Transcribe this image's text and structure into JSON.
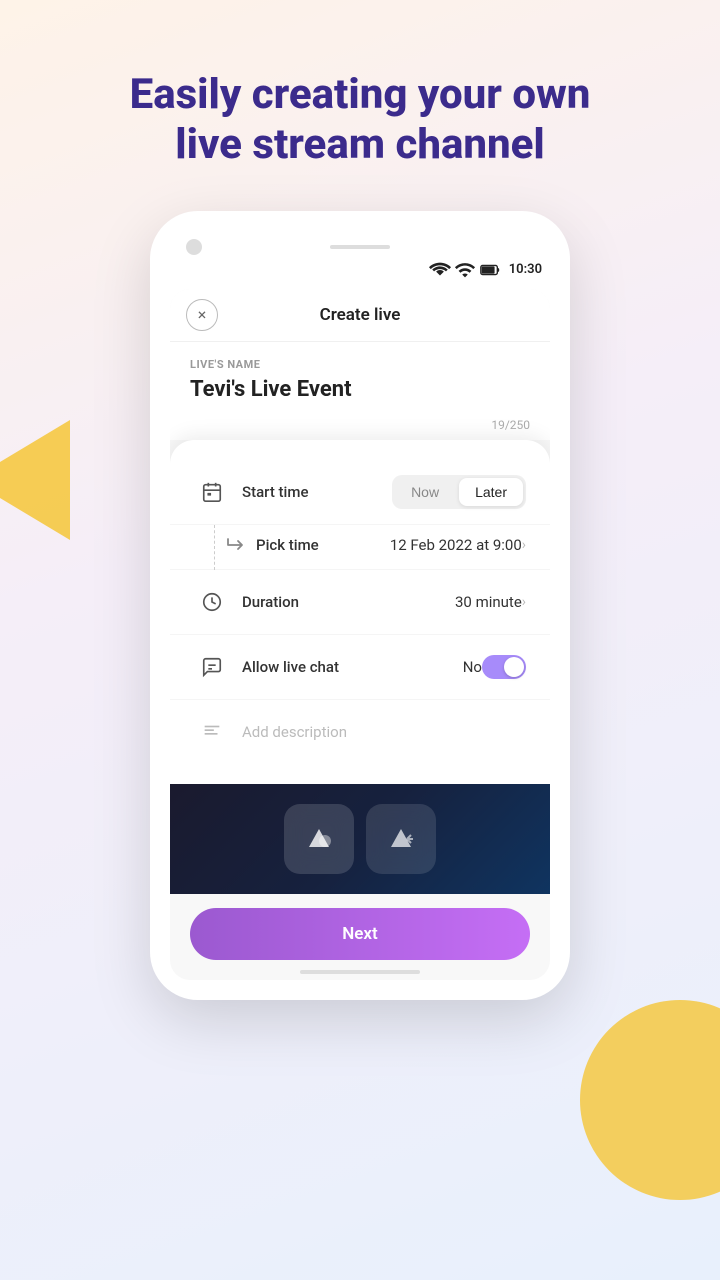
{
  "header": {
    "title_line1": "Easily creating your own",
    "title_line2": "live stream channel"
  },
  "status_bar": {
    "time": "10:30"
  },
  "create_live": {
    "header_title": "Create live",
    "close_label": "×",
    "live_name_label": "LIVE'S NAME",
    "live_name_value": "Tevi's Live Event",
    "char_count": "19/250"
  },
  "settings": {
    "start_time_label": "Start time",
    "start_time_now": "Now",
    "start_time_later": "Later",
    "pick_time_label": "Pick time",
    "pick_time_value": "12 Feb 2022 at 9:00",
    "duration_label": "Duration",
    "duration_value": "30 minute",
    "allow_chat_label": "Allow live chat",
    "allow_chat_status": "No",
    "description_placeholder": "Add description"
  },
  "next_button": "Next"
}
